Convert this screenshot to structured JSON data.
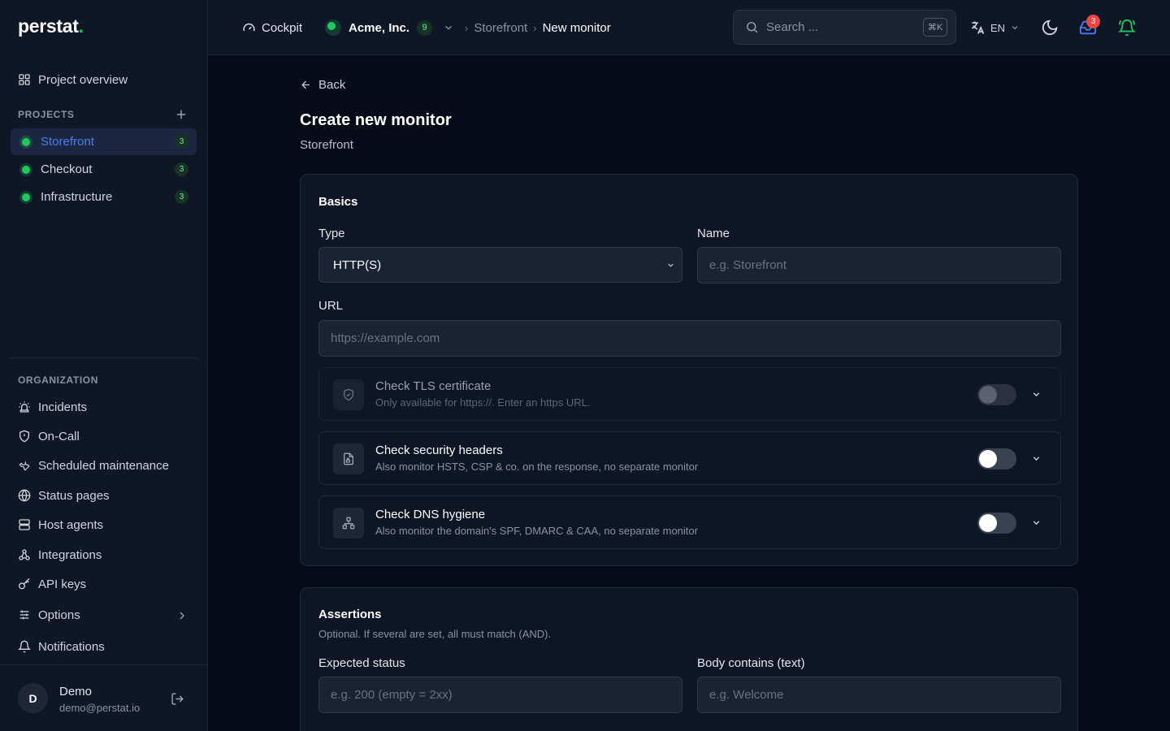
{
  "app": {
    "logo": "perstat",
    "logo_dot": "."
  },
  "sidebar": {
    "overview_label": "Project overview",
    "projects_heading": "PROJECTS",
    "projects": [
      {
        "name": "Storefront",
        "count": "3",
        "active": true
      },
      {
        "name": "Checkout",
        "count": "3",
        "active": false
      },
      {
        "name": "Infrastructure",
        "count": "3",
        "active": false
      }
    ],
    "organization_heading": "ORGANIZATION",
    "org_items": [
      {
        "label": "Incidents",
        "icon": "siren-icon"
      },
      {
        "label": "On-Call",
        "icon": "shield-icon"
      },
      {
        "label": "Scheduled maintenance",
        "icon": "wrench-icon"
      },
      {
        "label": "Status pages",
        "icon": "globe-icon"
      },
      {
        "label": "Host agents",
        "icon": "server-icon"
      },
      {
        "label": "Integrations",
        "icon": "webhook-icon"
      },
      {
        "label": "API keys",
        "icon": "key-icon"
      },
      {
        "label": "Options",
        "icon": "sliders-icon"
      },
      {
        "label": "Notifications",
        "icon": "bell-icon"
      }
    ],
    "user": {
      "initial": "D",
      "name": "Demo",
      "email": "demo@perstat.io"
    }
  },
  "header": {
    "cockpit_label": "Cockpit",
    "org_name": "Acme, Inc.",
    "org_count": "9",
    "breadcrumb": {
      "sep": "›",
      "project": "Storefront",
      "current": "New monitor"
    },
    "search": {
      "placeholder": "Search ...",
      "shortcut": "⌘K"
    },
    "language": "EN",
    "notification_count": "3"
  },
  "main": {
    "back_label": "Back",
    "title": "Create new monitor",
    "subtitle": "Storefront",
    "basics": {
      "heading": "Basics",
      "type_label": "Type",
      "type_value": "HTTP(S)",
      "name_label": "Name",
      "name_placeholder": "e.g. Storefront",
      "url_label": "URL",
      "url_placeholder": "https://example.com",
      "checks": [
        {
          "title": "Check TLS certificate",
          "desc": "Only available for https://. Enter an https URL.",
          "icon": "shield-check-icon",
          "enabled": false,
          "disabled": true
        },
        {
          "title": "Check security headers",
          "desc": "Also monitor HSTS, CSP & co. on the response, no separate monitor",
          "icon": "file-lock-icon",
          "enabled": false,
          "disabled": false
        },
        {
          "title": "Check DNS hygiene",
          "desc": "Also monitor the domain's SPF, DMARC & CAA, no separate monitor",
          "icon": "network-icon",
          "enabled": false,
          "disabled": false
        }
      ]
    },
    "assertions": {
      "heading": "Assertions",
      "subtitle": "Optional. If several are set, all must match (AND).",
      "status_label": "Expected status",
      "status_placeholder": "e.g. 200 (empty = 2xx)",
      "body_label": "Body contains (text)",
      "body_placeholder": "e.g. Welcome"
    }
  },
  "colors": {
    "accent": "#4a7cf0",
    "success": "#22c55e",
    "danger": "#ef4444",
    "background": "#060b18",
    "surface": "#0f1626"
  }
}
